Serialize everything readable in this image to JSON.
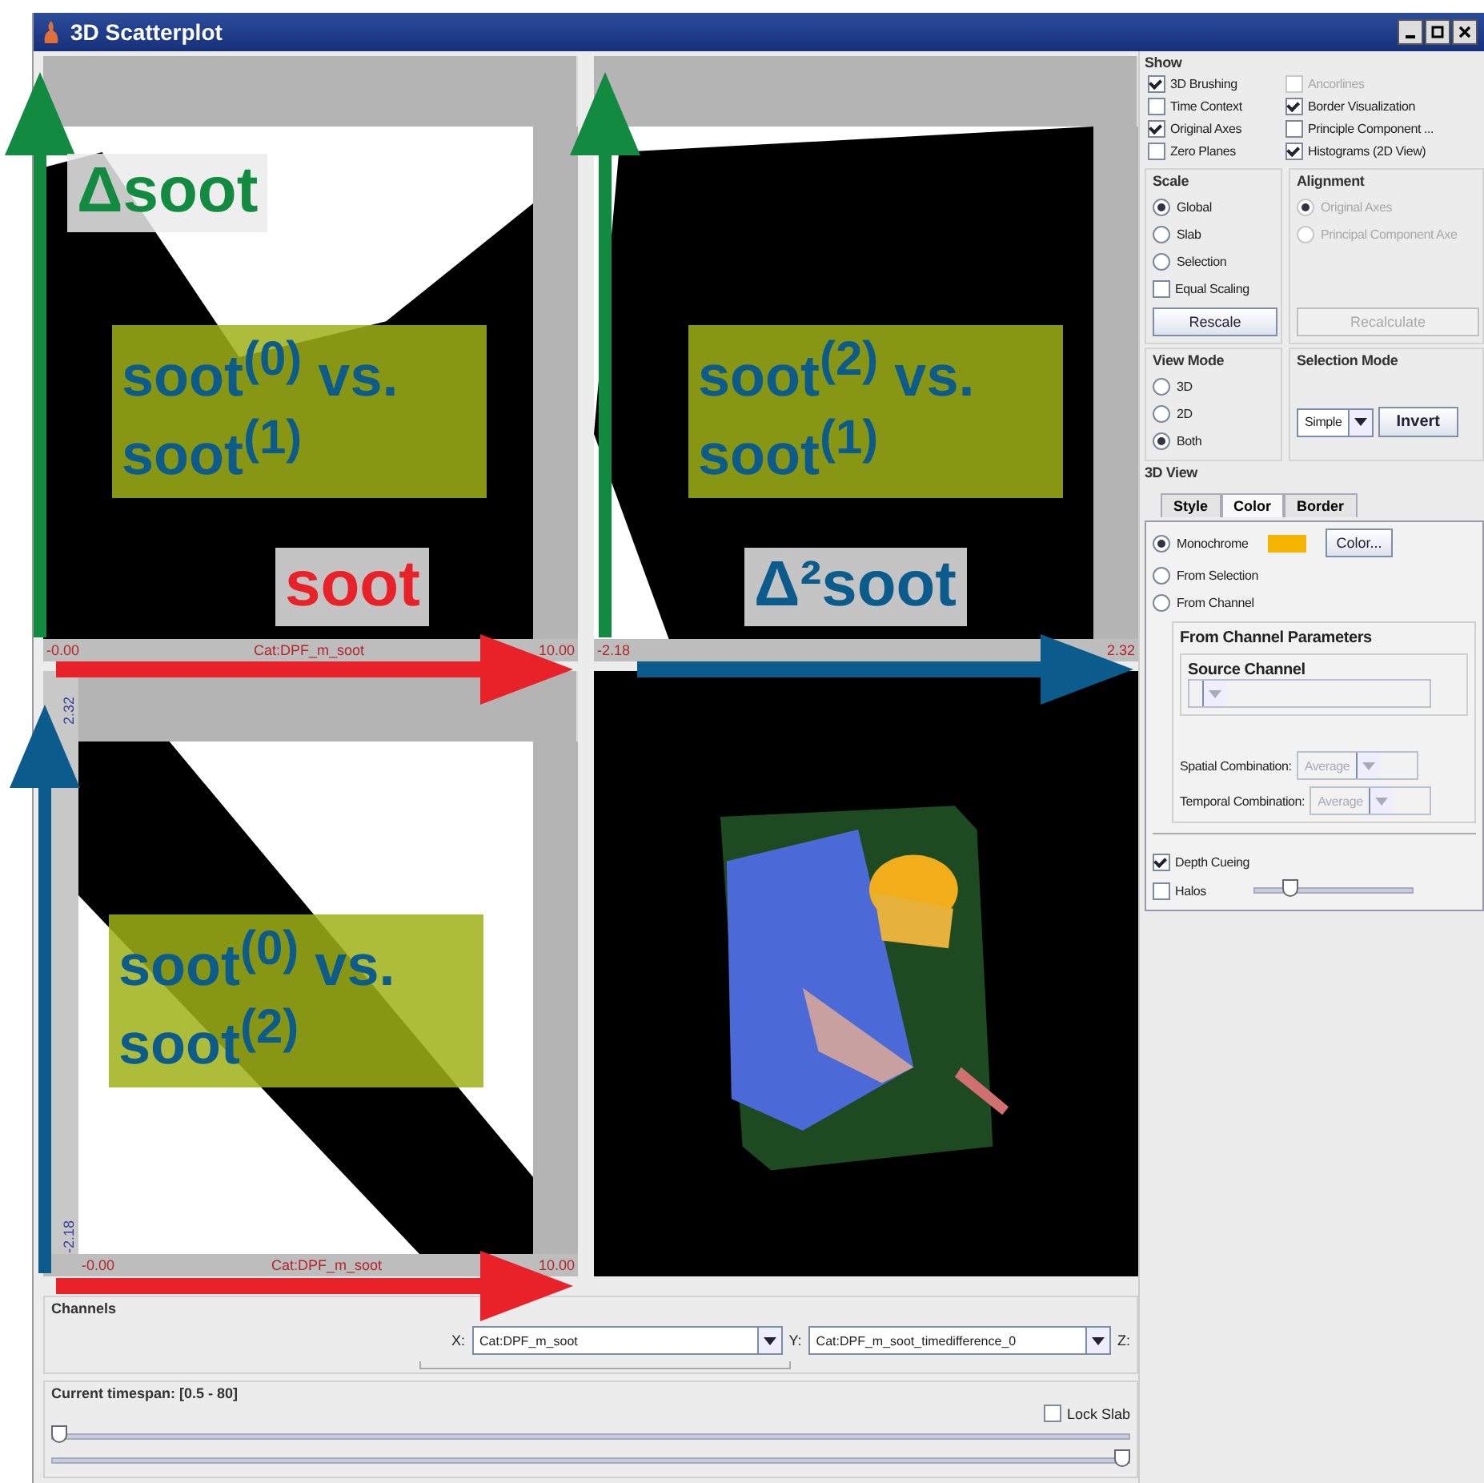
{
  "window": {
    "title": "3D Scatterplot"
  },
  "plots": [
    {
      "kind": "scatter",
      "x_min": "-0.00",
      "x_label": "Cat:DPF_m_soot",
      "x_max": "10.00"
    },
    {
      "kind": "scatter",
      "x_min": "-2.18",
      "x_max": "2.32"
    },
    {
      "kind": "scatter",
      "y_max": "2.32",
      "y_min": "-2.18",
      "x_min": "-0.00",
      "x_label": "Cat:DPF_m_soot",
      "x_max": "10.00"
    },
    {
      "kind": "cube"
    }
  ],
  "annotations": {
    "arrows": [
      {
        "kind": "up",
        "color": "#128a3f"
      },
      {
        "kind": "up",
        "color": "#128a3f"
      },
      {
        "kind": "right",
        "color": "#e92128"
      },
      {
        "kind": "right",
        "color": "#0b5b8c"
      },
      {
        "kind": "up",
        "color": "#0b5b8c"
      },
      {
        "kind": "right",
        "color": "#e92128"
      }
    ],
    "axis_labels": [
      {
        "text": "Δsoot",
        "color": "#128a3f"
      },
      {
        "text": "soot",
        "color": "#e92128"
      },
      {
        "text": "Δ²soot",
        "color": "#0b5b8c"
      }
    ],
    "plot_labels": [
      "soot$^{(0)}$ vs. soot$^{(1)}$",
      "soot$^{(2)}$ vs. soot$^{(1)}$",
      "soot$^{(0)}$ vs. soot$^{(2)}$"
    ]
  },
  "channels": {
    "title": "Channels",
    "x_label": "X:",
    "x_value": "Cat:DPF_m_soot",
    "y_label": "Y:",
    "y_value": "Cat:DPF_m_soot_timedifference_0",
    "z_label": "Z:"
  },
  "timespan": {
    "title": "Current timespan: [0.5 - 80]",
    "lock_slab": {
      "label": "Lock Slab",
      "checked": false
    },
    "sliders": [
      {
        "level": 0
      },
      {
        "level": 1
      }
    ]
  },
  "show": {
    "title": "Show",
    "options": [
      {
        "label": "3D Brushing",
        "checked": true,
        "disabled": false
      },
      {
        "label": "Ancorlines",
        "checked": false,
        "disabled": true
      },
      {
        "label": "Time Context",
        "checked": false,
        "disabled": false
      },
      {
        "label": "Border Visualization",
        "checked": true,
        "disabled": false
      },
      {
        "label": "Original Axes",
        "checked": true,
        "disabled": false
      },
      {
        "label": "Principle Component ...",
        "checked": false,
        "disabled": false
      },
      {
        "label": "Zero Planes",
        "checked": false,
        "disabled": false
      },
      {
        "label": "Histograms (2D View)",
        "checked": true,
        "disabled": false
      }
    ]
  },
  "scale": {
    "title": "Scale",
    "options": [
      {
        "label": "Global",
        "selected": true
      },
      {
        "label": "Slab",
        "selected": false
      },
      {
        "label": "Selection",
        "selected": false
      }
    ],
    "equal_scaling": {
      "label": "Equal Scaling",
      "checked": false
    },
    "button": "Rescale"
  },
  "alignment": {
    "title": "Alignment",
    "disabled": true,
    "options": [
      {
        "label": "Original Axes",
        "selected": true
      },
      {
        "label": "Principal Component Axe",
        "selected": false
      }
    ],
    "button": "Recalculate"
  },
  "view_mode": {
    "title": "View Mode",
    "options": [
      {
        "label": "3D",
        "selected": false
      },
      {
        "label": "2D",
        "selected": false
      },
      {
        "label": "Both",
        "selected": true
      }
    ]
  },
  "selection_mode": {
    "title": "Selection Mode",
    "combo": "Simple",
    "button": "Invert"
  },
  "view_3d": {
    "title": "3D View",
    "tabs": [
      {
        "label": "Style",
        "selected": false
      },
      {
        "label": "Color",
        "selected": true
      },
      {
        "label": "Border",
        "selected": false
      }
    ],
    "color_options": [
      {
        "label": "Monochrome",
        "selected": true
      },
      {
        "label": "From Selection",
        "selected": false
      },
      {
        "label": "From Channel",
        "selected": false
      }
    ],
    "swatch": {
      "color": "#f6b400"
    },
    "color_button": "Color...",
    "channel_params": {
      "title": "From Channel Parameters",
      "source_title": "Source Channel",
      "spatial_label": "Spatial Combination:",
      "spatial_value": "Average",
      "temporal_label": "Temporal Combination:",
      "temporal_value": "Average"
    },
    "depth_cueing": {
      "label": "Depth Cueing",
      "checked": true
    },
    "halos": {
      "label": "Halos",
      "checked": false
    },
    "halo_slider": {
      "level": 0.2
    }
  }
}
